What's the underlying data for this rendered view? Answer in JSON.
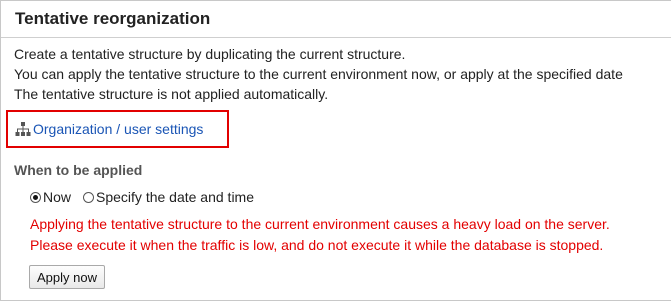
{
  "page": {
    "title": "Tentative reorganization"
  },
  "description": {
    "line1": "Create a tentative structure by duplicating the current structure.",
    "line2": "You can apply the tentative structure to the current environment now, or apply at the specified date",
    "line3": "The tentative structure is not applied automatically."
  },
  "org_link": {
    "icon": "org-chart-icon",
    "label": "Organization / user settings",
    "color": "#1a55b5",
    "highlight_color": "#e20000"
  },
  "apply_timing": {
    "label": "When to be applied",
    "options": [
      {
        "label": "Now",
        "checked": true
      },
      {
        "label": "Specify the date and time",
        "checked": false
      }
    ]
  },
  "warning": {
    "line1": "Applying the tentative structure to the current environment causes a heavy load on the server.",
    "line2": "Please execute it when the traffic is low, and do not execute it while the database is stopped.",
    "color": "#e30000"
  },
  "actions": {
    "apply_label": "Apply now"
  }
}
